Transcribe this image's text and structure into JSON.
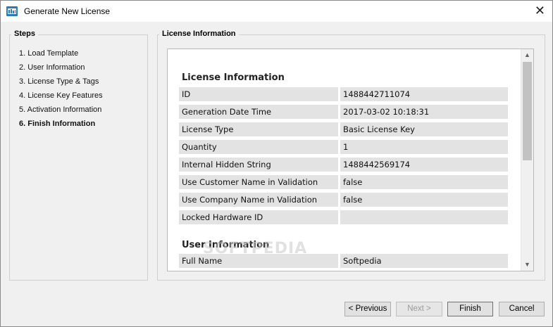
{
  "window": {
    "title": "Generate New License",
    "close_glyph": "✕"
  },
  "steps": {
    "legend": "Steps",
    "items": [
      {
        "label": "1. Load Template",
        "active": false
      },
      {
        "label": "2. User Information",
        "active": false
      },
      {
        "label": "3. License Type & Tags",
        "active": false
      },
      {
        "label": "4. License Key Features",
        "active": false
      },
      {
        "label": "5. Activation Information",
        "active": false
      },
      {
        "label": "6. Finish Information",
        "active": true
      }
    ]
  },
  "info": {
    "legend": "License Information",
    "section_license": "License Information",
    "rows": [
      {
        "key": "ID",
        "value": "1488442711074"
      },
      {
        "key": "Generation Date Time",
        "value": "2017-03-02 10:18:31"
      },
      {
        "key": "License Type",
        "value": "Basic License Key"
      },
      {
        "key": "Quantity",
        "value": "1"
      },
      {
        "key": "Internal Hidden String",
        "value": "1488442569174"
      },
      {
        "key": "Use Customer Name in Validation",
        "value": "false"
      },
      {
        "key": "Use Company Name in Validation",
        "value": "false"
      },
      {
        "key": "Locked Hardware ID",
        "value": ""
      }
    ],
    "section_user": "User Information",
    "user_rows": [
      {
        "key": "Full Name",
        "value": "Softpedia"
      }
    ],
    "watermark": "SOFTPEDIA"
  },
  "buttons": {
    "previous": "< Previous",
    "next": "Next >",
    "finish": "Finish",
    "cancel": "Cancel"
  },
  "icons": {
    "app": "license-app-icon",
    "close": "close-icon",
    "scroll_up": "scroll-up-arrow-icon",
    "scroll_down": "scroll-down-arrow-icon"
  },
  "colors": {
    "window_bg": "#f0f0f0",
    "cell_bg": "#e3e3e3",
    "default_button_border": "#2a7fd4"
  }
}
